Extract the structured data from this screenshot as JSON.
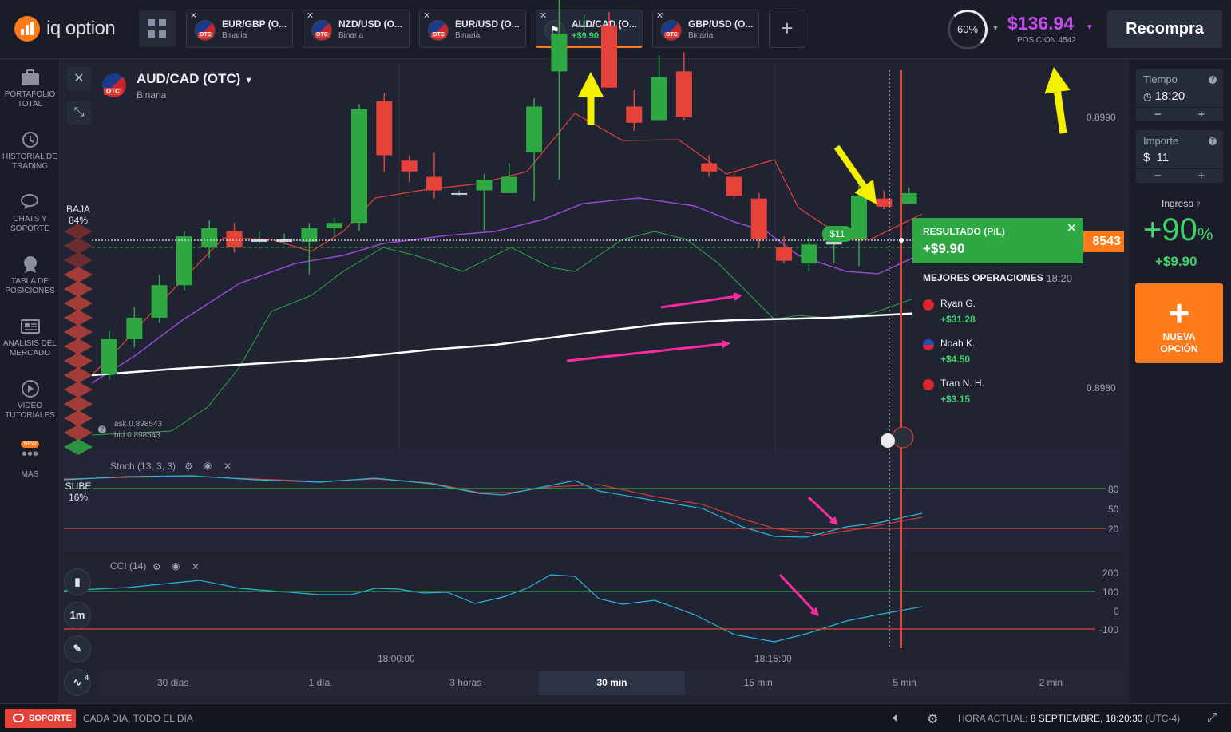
{
  "brand": {
    "name": "iq option"
  },
  "tabs": [
    {
      "name": "EUR/GBP (O...",
      "sub": "Binaria"
    },
    {
      "name": "NZD/USD (O...",
      "sub": "Binaria"
    },
    {
      "name": "EUR/USD (O...",
      "sub": "Binaria"
    },
    {
      "name": "AUD/CAD (O...",
      "sub": "+$9.90"
    },
    {
      "name": "GBP/USD (O...",
      "sub": "Binaria"
    }
  ],
  "header": {
    "ring_pct": "60%",
    "balance": "$136.94",
    "balance_sub": "POSICION 4542",
    "recompra": "Recompra"
  },
  "sidebar": [
    {
      "label1": "PORTAFOLIO",
      "label2": "TOTAL",
      "icon": "briefcase-icon"
    },
    {
      "label1": "HISTORIAL DE",
      "label2": "TRADING",
      "icon": "history-icon"
    },
    {
      "label1": "CHATS Y",
      "label2": "SOPORTE",
      "icon": "chat-icon"
    },
    {
      "label1": "TABLA DE",
      "label2": "POSICIONES",
      "icon": "medal-icon"
    },
    {
      "label1": "ANALISIS DEL",
      "label2": "MERCADO",
      "icon": "news-icon"
    },
    {
      "label1": "VIDEO",
      "label2": "TUTORIALES",
      "icon": "play-icon"
    },
    {
      "label1": "MAS",
      "label2": "",
      "icon": "more-icon",
      "badge": "NEW"
    }
  ],
  "asset": {
    "name": "AUD/CAD (OTC)",
    "type": "Binaria",
    "otc": "OTC"
  },
  "sentiment": {
    "baja_label": "BAJA",
    "baja_pct": "84%",
    "sube_label": "SUBE",
    "sube_pct": "16%"
  },
  "quote": {
    "ask": "ask 0.898543",
    "bid": "bid 0.898543",
    "price_tag": "8543",
    "bubble": "$11"
  },
  "result": {
    "title": "RESULTADO (P/L)",
    "amount": "+$9.90"
  },
  "mejores": {
    "title": "MEJORES OPERACIONES",
    "time": "18:20",
    "traders": [
      {
        "name": "Ryan G.",
        "profit": "+$31.28",
        "flag": "#d8262e"
      },
      {
        "name": "Noah K.",
        "profit": "+$4.50",
        "flag": "#1d4fb8"
      },
      {
        "name": "Tran N. H.",
        "profit": "+$3.15",
        "flag": "#d8262e"
      }
    ]
  },
  "right": {
    "tiempo_label": "Tiempo",
    "tiempo_value": "18:20",
    "importe_label": "Importe",
    "importe_value": "$  11",
    "ingreso_label": "Ingreso",
    "ingreso_pct": "+90",
    "ingreso_pct_sym": "%",
    "ingreso_amt": "+$9.90",
    "nueva1": "NUEVA",
    "nueva2": "OPCIÓN"
  },
  "price_axis": {
    "top": "0.8990",
    "bottom": "0.8980"
  },
  "stoch": {
    "label": "Stoch (13, 3, 3)",
    "levels": [
      "80",
      "50",
      "20"
    ]
  },
  "cci": {
    "label": "CCI (14)",
    "levels": [
      "200",
      "100",
      "0",
      "-100"
    ]
  },
  "time_axis": [
    "18:00:00",
    "18:15:00"
  ],
  "timeframes": [
    "30 días",
    "1 día",
    "3 horas",
    "30 min",
    "15 min",
    "5 min",
    "2 min"
  ],
  "active_timeframe": 3,
  "chart_tools": {
    "period": "1m",
    "indicator_count": "4"
  },
  "footer": {
    "soporte": "SOPORTE",
    "cada": "CADA DIA, TODO EL DIA",
    "hora_label": "HORA ACTUAL:",
    "hora_value": "8 SEPTIEMBRE, 18:20:30",
    "tz": "(UTC-4)"
  },
  "colors": {
    "accent": "#ff7a1a",
    "up": "#2ea843",
    "down": "#e5423a",
    "balance": "#c74cf0"
  },
  "candles": [
    [
      0.89805,
      0.89818,
      0.89803,
      0.89821
    ],
    [
      0.89818,
      0.89826,
      0.89815,
      0.8983
    ],
    [
      0.89826,
      0.89838,
      0.89824,
      0.89842
    ],
    [
      0.89838,
      0.89856,
      0.89836,
      0.89858
    ],
    [
      0.89852,
      0.89859,
      0.89848,
      0.89862
    ],
    [
      0.89858,
      0.89852,
      0.8985,
      0.89861
    ],
    [
      0.89854,
      0.89855,
      0.89853,
      0.89858
    ],
    [
      0.89854,
      0.89855,
      0.89853,
      0.89857
    ],
    [
      0.89854,
      0.89859,
      0.89842,
      0.89861
    ],
    [
      0.89859,
      0.89861,
      0.89856,
      0.89863
    ],
    [
      0.89861,
      0.89903,
      0.89858,
      0.89905
    ],
    [
      0.89906,
      0.89886,
      0.8988,
      0.89909
    ],
    [
      0.89884,
      0.8988,
      0.89876,
      0.89886
    ],
    [
      0.89878,
      0.89873,
      0.8987,
      0.89887
    ],
    [
      0.89872,
      0.89872,
      0.89871,
      0.89873
    ],
    [
      0.89873,
      0.89877,
      0.89858,
      0.89879
    ],
    [
      0.89872,
      0.89878,
      0.89872,
      0.89883
    ],
    [
      0.89887,
      0.89904,
      0.89869,
      0.89907
    ],
    [
      0.89917,
      0.89931,
      0.89877,
      0.89946
    ],
    [
      0.89934,
      0.89934,
      0.89932,
      0.89938
    ],
    [
      0.89934,
      0.89911,
      0.89911,
      0.89939
    ],
    [
      0.89904,
      0.89898,
      0.89895,
      0.8991
    ],
    [
      0.89899,
      0.89915,
      0.89899,
      0.89923
    ],
    [
      0.89917,
      0.899,
      0.89899,
      0.89924
    ],
    [
      0.89883,
      0.8988,
      0.89878,
      0.89886
    ],
    [
      0.89878,
      0.89871,
      0.8987,
      0.8988
    ],
    [
      0.8987,
      0.89855,
      0.89852,
      0.89872
    ],
    [
      0.89852,
      0.89847,
      0.89846,
      0.89856
    ],
    [
      0.89846,
      0.89853,
      0.89843,
      0.89856
    ],
    [
      0.89853,
      0.89854,
      0.89846,
      0.89858
    ],
    [
      0.89855,
      0.89871,
      0.89845,
      0.89875
    ],
    [
      0.8987,
      0.89867,
      0.89866,
      0.89873
    ],
    [
      0.89868,
      0.89872,
      0.89868,
      0.89874
    ]
  ]
}
